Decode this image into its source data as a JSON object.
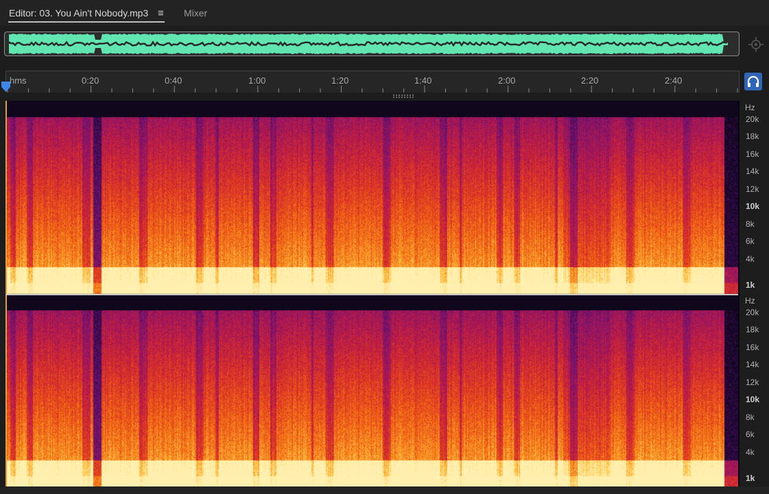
{
  "tabs": {
    "editor_label": "Editor: 03. You Ain't Nobody.mp3",
    "menu_icon": "≡",
    "mixer_label": "Mixer"
  },
  "overview": {
    "waveform_color": "#61e6b2",
    "frame_color": "#8b8b8b"
  },
  "ruler": {
    "unit_label": "hms",
    "time_labels": [
      "0:20",
      "0:40",
      "1:00",
      "1:20",
      "1:40",
      "2:00",
      "2:20",
      "2:40"
    ]
  },
  "controls": {
    "zoom_icon": "zoom-to-selection-icon",
    "monitor_icon": "headphones-icon",
    "playhead_color": "#3b86e6",
    "monitor_bg": "#2f65b6"
  },
  "frequency_axis": {
    "unit": "Hz",
    "labels": [
      "20k",
      "18k",
      "16k",
      "14k",
      "12k",
      "10k",
      "8k",
      "6k",
      "4k",
      "1k"
    ],
    "bold_labels": [
      "10k",
      "1k"
    ]
  },
  "spectrogram": {
    "channels": 2,
    "palette": [
      "#080612",
      "#3a0a55",
      "#7a1470",
      "#b8184a",
      "#e23a1e",
      "#f57a14",
      "#ffc84a",
      "#fff0b0"
    ]
  }
}
